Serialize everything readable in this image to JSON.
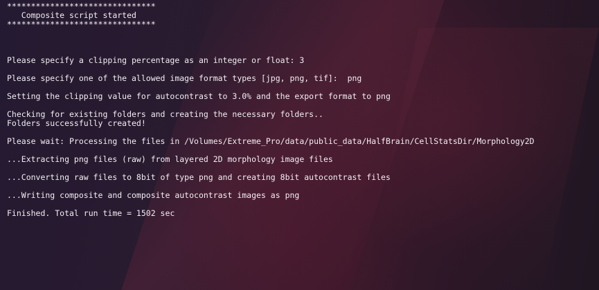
{
  "terminal": {
    "lines": [
      "*******************************",
      "   Composite script started",
      "*******************************",
      "",
      "",
      "",
      "Please specify a clipping percentage as an integer or float: 3",
      "",
      "Please specify one of the allowed image format types [jpg, png, tif]:  png",
      "",
      "Setting the clipping value for autocontrast to 3.0% and the export format to png",
      "",
      "Checking for existing folders and creating the necessary folders..",
      "Folders successfully created!",
      "",
      "Please wait: Processing the files in /Volumes/Extreme_Pro/data/public_data/HalfBrain/CellStatsDir/Morphology2D",
      "",
      "...Extracting png files (raw) from layered 2D morphology image files",
      "",
      "...Converting raw files to 8bit of type png and creating 8bit autocontrast files",
      "",
      "...Writing composite and composite autocontrast images as png",
      "",
      "Finished. Total run time = 1502 sec"
    ]
  }
}
